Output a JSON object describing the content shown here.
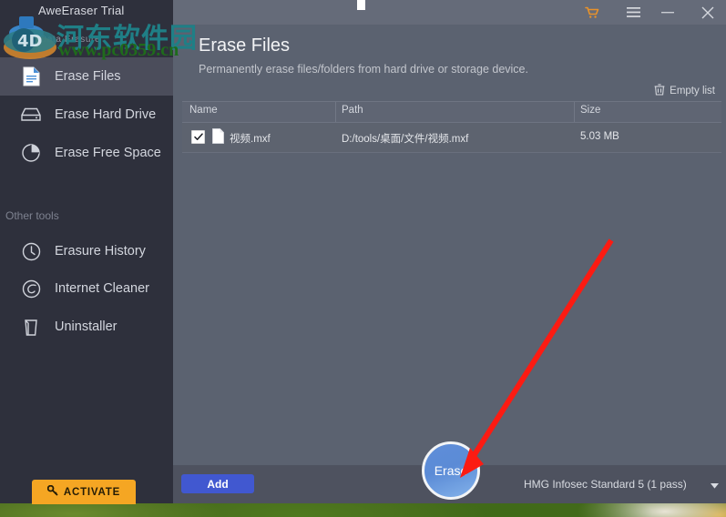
{
  "window": {
    "title": "AweEraser Trial",
    "brand_subtitle": "Data Erasure",
    "titlebar_buttons": [
      {
        "name": "cart-icon",
        "label": "",
        "color": "#e8922a"
      },
      {
        "name": "menu-icon",
        "label": ""
      },
      {
        "name": "minimize-button",
        "label": ""
      },
      {
        "name": "close-button",
        "label": ""
      }
    ]
  },
  "sidebar": {
    "section_label": "Other tools",
    "items": [
      {
        "label": "Erase Files",
        "icon": "file-document-icon",
        "active": true
      },
      {
        "label": "Erase Hard Drive",
        "icon": "hard-drive-icon",
        "active": false
      },
      {
        "label": "Erase Free Space",
        "icon": "pie-chart-icon",
        "active": false
      },
      {
        "label": "Erasure History",
        "icon": "clock-icon",
        "active": false
      },
      {
        "label": "Internet Cleaner",
        "icon": "globe-spiral-icon",
        "active": false
      },
      {
        "label": "Uninstaller",
        "icon": "trash-bucket-icon",
        "active": false
      }
    ],
    "activate_button": "ACTIVATE"
  },
  "main": {
    "title": "Erase Files",
    "subtitle": "Permanently erase files/folders from hard drive or storage device.",
    "empty_list_label": "Empty list",
    "table": {
      "columns": [
        "Name",
        "Path",
        "Size"
      ],
      "rows": [
        {
          "checked": true,
          "name": "视频.mxf",
          "path": "D:/tools/桌面/文件/视频.mxf",
          "size": "5.03 MB"
        }
      ]
    },
    "bottom": {
      "add_button": "Add",
      "erase_button": "Erase",
      "method_selected": "HMG Infosec Standard 5 (1 pass)"
    }
  },
  "annotation": {
    "arrow_color": "#fc1b12",
    "arrow_from": "672,265",
    "arrow_to": "508,522"
  },
  "watermark": {
    "site_cn": "河东软件园",
    "site_url": "www.pc0359.cn"
  },
  "colors": {
    "sidebar_bg": "#2e303c",
    "content_bg": "#5b6270",
    "titlebar_bg": "#656b79",
    "accent_orange": "#f5a623",
    "accent_blue": "#4158d0",
    "erase_blue": "#5b8bd6"
  }
}
